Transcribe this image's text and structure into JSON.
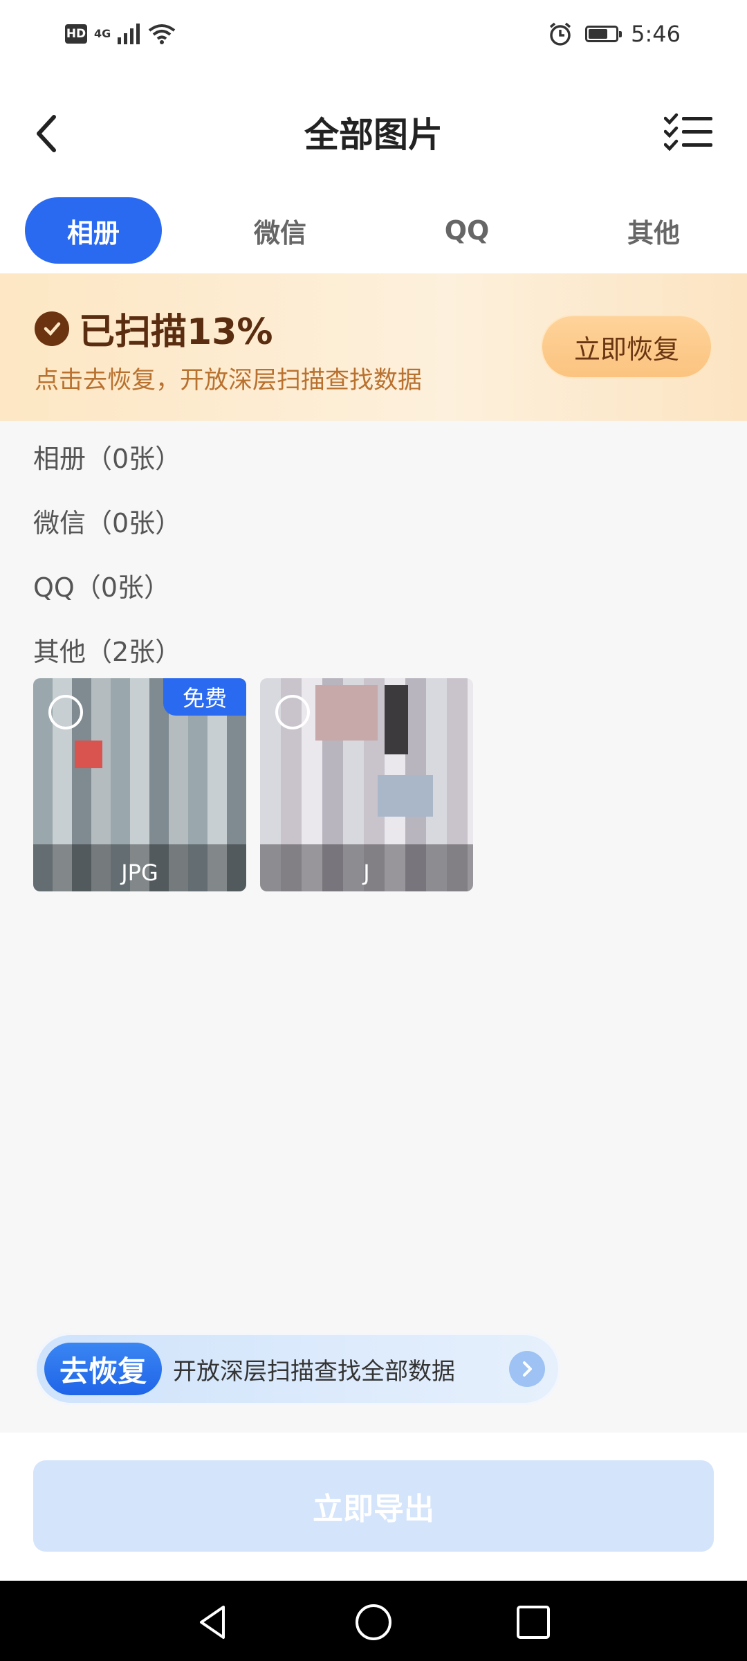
{
  "status_bar": {
    "hd": "HD",
    "network": "4G",
    "time": "5:46",
    "battery_level": 0.7
  },
  "header": {
    "title": "全部图片",
    "back_icon": "chevron-left-icon",
    "select_icon": "checklist-icon"
  },
  "tabs": [
    {
      "label": "相册",
      "active": true
    },
    {
      "label": "微信",
      "active": false
    },
    {
      "label": "QQ",
      "active": false
    },
    {
      "label": "其他",
      "active": false
    }
  ],
  "banner": {
    "title": "已扫描13%",
    "subtitle": "点击去恢复，开放深层扫描查找数据",
    "button": "立即恢复"
  },
  "categories": [
    {
      "label": "相册（0张）"
    },
    {
      "label": "微信（0张）"
    },
    {
      "label": "QQ（0张）"
    },
    {
      "label": "其他（2张）"
    }
  ],
  "thumbnails": [
    {
      "caption": "JPG",
      "badge": "免费"
    },
    {
      "caption": "J",
      "badge": ""
    }
  ],
  "deep_scan": {
    "pill": "去恢复",
    "text": "开放深层扫描查找全部数据"
  },
  "export": {
    "label": "立即导出"
  },
  "accent_color": "#2a6af0"
}
